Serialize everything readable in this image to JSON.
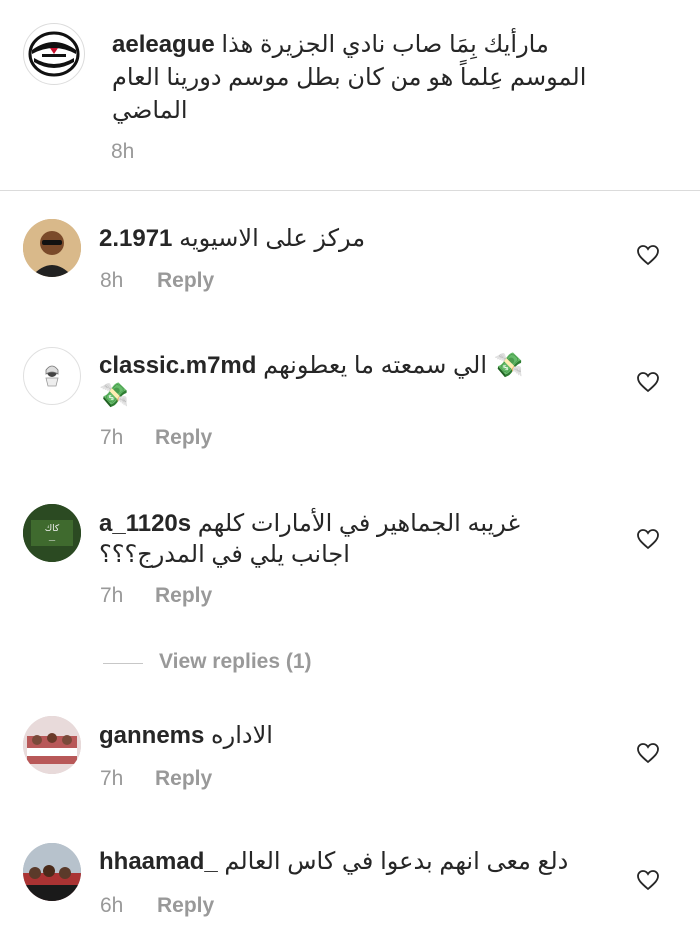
{
  "caption": {
    "username": "aeleague",
    "line1": "مارأيك بِمَا صاب نادي الجزيرة هذا",
    "line2": "الموسم عِلماً هو من كان بطل موسم دورينا العام",
    "line3": "الماضي",
    "time": "8h"
  },
  "comments": [
    {
      "username": "2.1971",
      "text": "مركز على الاسيويه",
      "time": "8h",
      "reply": "Reply"
    },
    {
      "username": "classic.m7md",
      "text": "الي  سمعته ما يعطونهم",
      "emoji": "💸",
      "time": "7h",
      "reply": "Reply"
    },
    {
      "username": "a_1120s",
      "text": "غريبه الجماهير في الأمارات كلهم",
      "text2": "اجانب يلي في المدرج؟؟؟",
      "time": "7h",
      "reply": "Reply"
    },
    {
      "username": "gannems",
      "text": "الاداره",
      "time": "7h",
      "reply": "Reply"
    },
    {
      "username": "hhaamad_",
      "text": "دلع معى انهم بدعوا في كاس العالم",
      "time": "6h",
      "reply": "Reply"
    }
  ],
  "view_replies": "View replies (1)",
  "icons": {
    "like": "heart-outline-icon",
    "league_logo": "ae-league-logo"
  },
  "colors": {
    "text": "#262626",
    "secondary": "#999999",
    "divider": "#dbdbdb"
  }
}
